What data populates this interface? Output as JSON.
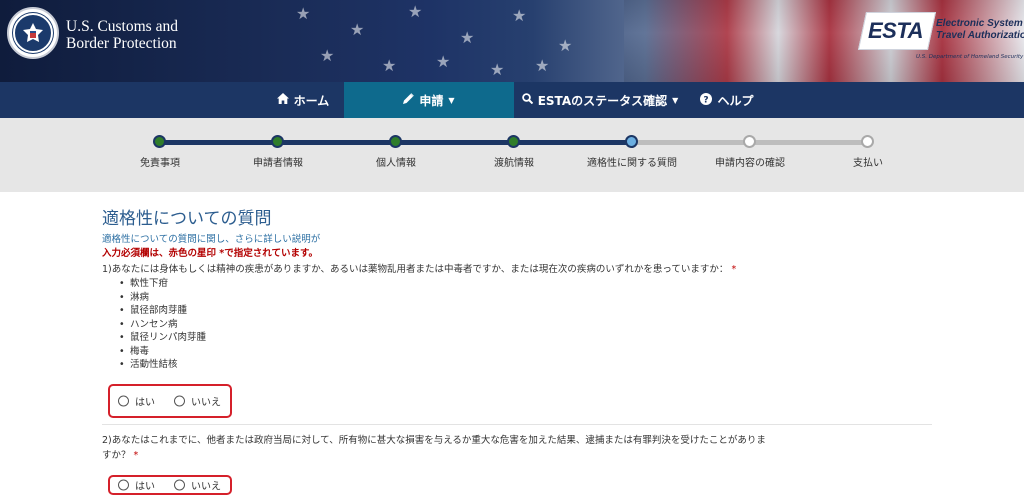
{
  "header": {
    "agency_line1": "U.S. Customs and",
    "agency_line2": "Border Protection",
    "seal_icon": "dhs-seal-icon",
    "esta_logo_text": "ESTA",
    "esta_desc_line1": "Electronic System for",
    "esta_desc_line2": "Travel Authorization",
    "esta_dept": "U.S. Department of Homeland Security"
  },
  "nav": {
    "items": [
      {
        "icon": "home-icon",
        "label": "ホーム",
        "active": false
      },
      {
        "icon": "pencil-icon",
        "label": "申請",
        "dropdown": true,
        "active": true
      },
      {
        "icon": "search-icon",
        "label": "ESTAのステータス確認",
        "dropdown": true,
        "active": false
      },
      {
        "icon": "question-circle-icon",
        "label": "ヘルプ",
        "active": false
      }
    ]
  },
  "progress": {
    "steps": [
      {
        "label": "免責事項",
        "state": "done"
      },
      {
        "label": "申請者情報",
        "state": "done"
      },
      {
        "label": "個人情報",
        "state": "done"
      },
      {
        "label": "渡航情報",
        "state": "done"
      },
      {
        "label": "適格性に関する質問",
        "state": "current"
      },
      {
        "label": "申請内容の確認",
        "state": "todo"
      },
      {
        "label": "支払い",
        "state": "todo"
      }
    ],
    "colors": {
      "done": "#2f7d2a",
      "current": "#6baee0",
      "todo": "#ffffff",
      "track_done": "#1c3664",
      "track_todo": "#bdbdbd"
    }
  },
  "main": {
    "title": "適格性についての質問",
    "subtitle": "適格性についての質問に関し、さらに詳しい説明が",
    "required_note": "入力必須欄は、赤色の星印 *で指定されています。",
    "questions": [
      {
        "text": "1)あなたには身体もしくは精神の疾患がありますか、あるいは薬物乱用者または中毒者ですか、または現在次の疾病のいずれかを患っていますか：",
        "required_mark": "*",
        "list": [
          "軟性下疳",
          "淋病",
          "鼠径部肉芽腫",
          "ハンセン病",
          "鼠径リンパ肉芽腫",
          "梅毒",
          "活動性結核"
        ],
        "options": [
          "はい",
          "いいえ"
        ],
        "selected": null
      },
      {
        "text_line1": "2)あなたはこれまでに、他者または政府当局に対して、所有物に甚大な損害を与えるか重大な危害を加えた結果、逮捕または有罪判決を受けたことがありま",
        "text_line2": "すか？",
        "required_mark": "*",
        "options": [
          "はい",
          "いいえ"
        ],
        "selected": null
      }
    ]
  }
}
